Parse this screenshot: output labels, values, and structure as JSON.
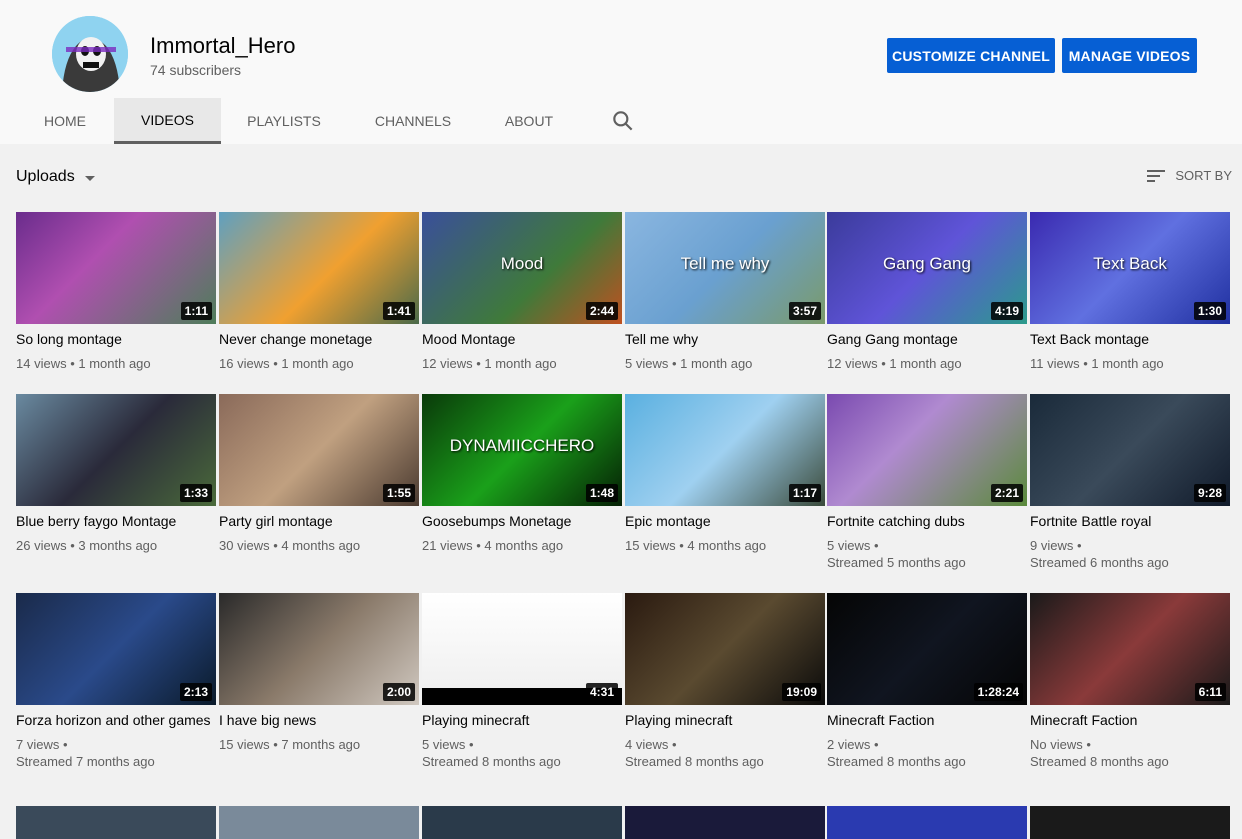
{
  "channel": {
    "name": "Immortal_Hero",
    "subscribers": "74 subscribers",
    "customize_label": "CUSTOMIZE CHANNEL",
    "manage_label": "MANAGE VIDEOS"
  },
  "tabs": [
    {
      "label": "HOME",
      "active": false
    },
    {
      "label": "VIDEOS",
      "active": true
    },
    {
      "label": "PLAYLISTS",
      "active": false
    },
    {
      "label": "CHANNELS",
      "active": false
    },
    {
      "label": "ABOUT",
      "active": false
    }
  ],
  "toolbar": {
    "uploads_label": "Uploads",
    "sort_label": "SORT BY"
  },
  "colors": {
    "accent": "#065fd4",
    "meta": "#606060"
  },
  "videos": [
    {
      "title": "So long montage",
      "views": "14 views",
      "age": "1 month ago",
      "duration": "1:11",
      "thumb_text": ""
    },
    {
      "title": "Never change monetage",
      "views": "16 views",
      "age": "1 month ago",
      "duration": "1:41",
      "thumb_text": ""
    },
    {
      "title": "Mood Montage",
      "views": "12 views",
      "age": "1 month ago",
      "duration": "2:44",
      "thumb_text": "Mood"
    },
    {
      "title": "Tell me why",
      "views": "5 views",
      "age": "1 month ago",
      "duration": "3:57",
      "thumb_text": "Tell me why"
    },
    {
      "title": "Gang Gang montage",
      "views": "12 views",
      "age": "1 month ago",
      "duration": "4:19",
      "thumb_text": "Gang Gang"
    },
    {
      "title": "Text Back montage",
      "views": "11 views",
      "age": "1 month ago",
      "duration": "1:30",
      "thumb_text": "Text Back"
    },
    {
      "title": "Blue berry faygo Montage",
      "views": "26 views",
      "age": "3 months ago",
      "duration": "1:33",
      "thumb_text": ""
    },
    {
      "title": "Party girl montage",
      "views": "30 views",
      "age": "4 months ago",
      "duration": "1:55",
      "thumb_text": ""
    },
    {
      "title": "Goosebumps Monetage",
      "views": "21 views",
      "age": "4 months ago",
      "duration": "1:48",
      "thumb_text": "DYNAMIICCHERO"
    },
    {
      "title": "Epic montage",
      "views": "15 views",
      "age": "4 months ago",
      "duration": "1:17",
      "thumb_text": ""
    },
    {
      "title": "Fortnite catching dubs",
      "views": "5 views",
      "age": "Streamed 5 months ago",
      "duration": "2:21",
      "thumb_text": "",
      "streamed": true
    },
    {
      "title": "Fortnite Battle royal",
      "views": "9 views",
      "age": "Streamed 6 months ago",
      "duration": "9:28",
      "thumb_text": "",
      "streamed": true
    },
    {
      "title": "Forza horizon and other games",
      "views": "7 views",
      "age": "Streamed 7 months ago",
      "duration": "2:13",
      "thumb_text": "",
      "streamed": true
    },
    {
      "title": "I have big news",
      "views": "15 views",
      "age": "7 months ago",
      "duration": "2:00",
      "thumb_text": ""
    },
    {
      "title": "Playing minecraft",
      "views": "5 views",
      "age": "Streamed 8 months ago",
      "duration": "4:31",
      "thumb_text": "",
      "streamed": true
    },
    {
      "title": "Playing minecraft",
      "views": "4 views",
      "age": "Streamed 8 months ago",
      "duration": "19:09",
      "thumb_text": "",
      "streamed": true
    },
    {
      "title": "Minecraft Faction",
      "views": "2 views",
      "age": "Streamed 8 months ago",
      "duration": "1:28:24",
      "thumb_text": "",
      "streamed": true
    },
    {
      "title": "Minecraft Faction",
      "views": "No views",
      "age": "Streamed 8 months ago",
      "duration": "6:11",
      "thumb_text": "",
      "streamed": true
    }
  ]
}
